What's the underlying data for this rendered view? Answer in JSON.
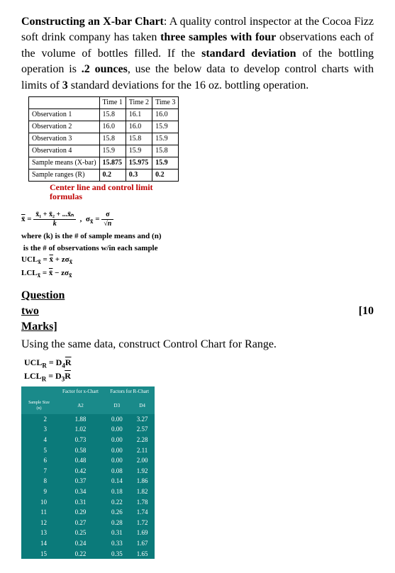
{
  "body": {
    "intro_html": "Constructing an X-bar Chart: A quality control inspector at the Cocoa Fizz soft drink company has taken three samples with four observations each of the volume of bottles filled. If the standard deviation of the bottling operation is .2 ounces, use the below data to develop control charts with limits of 3 standard deviations for the 16 oz. bottling operation.",
    "centerline1": "Center line and control limit",
    "centerline2": "formulas",
    "where1": "where (k) is the # of sample means and (n)",
    "where2": "is the # of observations w/in each sample",
    "ucl_formula": "UCL x̄ = x̄̄ + zσx̄",
    "lcl_formula": "LCL x̄ = x̄̄ − zσx̄",
    "question": "Question",
    "two": "two",
    "marks_right": "[10",
    "marks": "Marks]",
    "using": "Using the same data, construct Control Chart for Range.",
    "uclr": "UCLʀ = D₄R̄",
    "lclr": "LCLʀ = D₃R̄"
  },
  "chart_data": {
    "type": "table",
    "title": "Observations by Time",
    "columns": [
      "",
      "Time 1",
      "Time 2",
      "Time 3"
    ],
    "rows": [
      [
        "Observation 1",
        "15.8",
        "16.1",
        "16.0"
      ],
      [
        "Observation 2",
        "16.0",
        "16.0",
        "15.9"
      ],
      [
        "Observation 3",
        "15.8",
        "15.8",
        "15.9"
      ],
      [
        "Observation 4",
        "15.9",
        "15.9",
        "15.8"
      ],
      [
        "Sample means (X-bar)",
        "15.875",
        "15.975",
        "15.9"
      ],
      [
        "Sample ranges (R)",
        "0.2",
        "0.3",
        "0.2"
      ]
    ]
  },
  "factors": {
    "headers_top": [
      "",
      "Factor for x-Chart",
      "Factors for R-Chart",
      ""
    ],
    "headers": [
      "Sample Size (n)",
      "A2",
      "D3",
      "D4"
    ],
    "rows": [
      [
        "2",
        "1.88",
        "0.00",
        "3.27"
      ],
      [
        "3",
        "1.02",
        "0.00",
        "2.57"
      ],
      [
        "4",
        "0.73",
        "0.00",
        "2.28"
      ],
      [
        "5",
        "0.58",
        "0.00",
        "2.11"
      ],
      [
        "6",
        "0.48",
        "0.00",
        "2.00"
      ],
      [
        "7",
        "0.42",
        "0.08",
        "1.92"
      ],
      [
        "8",
        "0.37",
        "0.14",
        "1.86"
      ],
      [
        "9",
        "0.34",
        "0.18",
        "1.82"
      ],
      [
        "10",
        "0.31",
        "0.22",
        "1.78"
      ],
      [
        "11",
        "0.29",
        "0.26",
        "1.74"
      ],
      [
        "12",
        "0.27",
        "0.28",
        "1.72"
      ],
      [
        "13",
        "0.25",
        "0.31",
        "1.69"
      ],
      [
        "14",
        "0.24",
        "0.33",
        "1.67"
      ],
      [
        "15",
        "0.22",
        "0.35",
        "1.65"
      ]
    ]
  }
}
